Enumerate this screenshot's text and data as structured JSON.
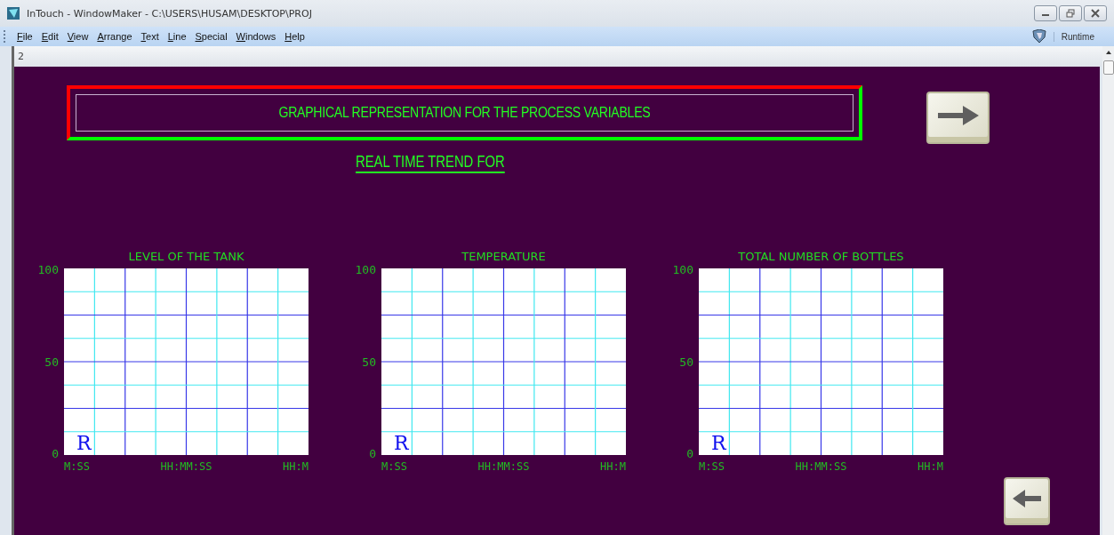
{
  "window": {
    "title": "InTouch - WindowMaker - C:\\USERS\\HUSAM\\DESKTOP\\PROJ",
    "runtime_button": "Runtime"
  },
  "menu": [
    "File",
    "Edit",
    "View",
    "Arrange",
    "Text",
    "Line",
    "Special",
    "Windows",
    "Help"
  ],
  "document_tab": "2",
  "header": {
    "title": "GRAPHICAL REPRESENTATION FOR THE PROCESS VARIABLES",
    "subtitle": "REAL TIME TREND FOR"
  },
  "trends": [
    {
      "title": "LEVEL OF THE TANK",
      "y_labels": [
        "100",
        "50",
        "0"
      ],
      "x_labels": [
        "M:SS",
        "HH:MM:SS",
        "HH:M"
      ],
      "marker": "R"
    },
    {
      "title": "TEMPERATURE",
      "y_labels": [
        "100",
        "50",
        "0"
      ],
      "x_labels": [
        "M:SS",
        "HH:MM:SS",
        "HH:M"
      ],
      "marker": "R"
    },
    {
      "title": "TOTAL NUMBER OF BOTTLES",
      "y_labels": [
        "100",
        "50",
        "0"
      ],
      "x_labels": [
        "M:SS",
        "HH:MM:SS",
        "HH:M"
      ],
      "marker": "R"
    }
  ]
}
